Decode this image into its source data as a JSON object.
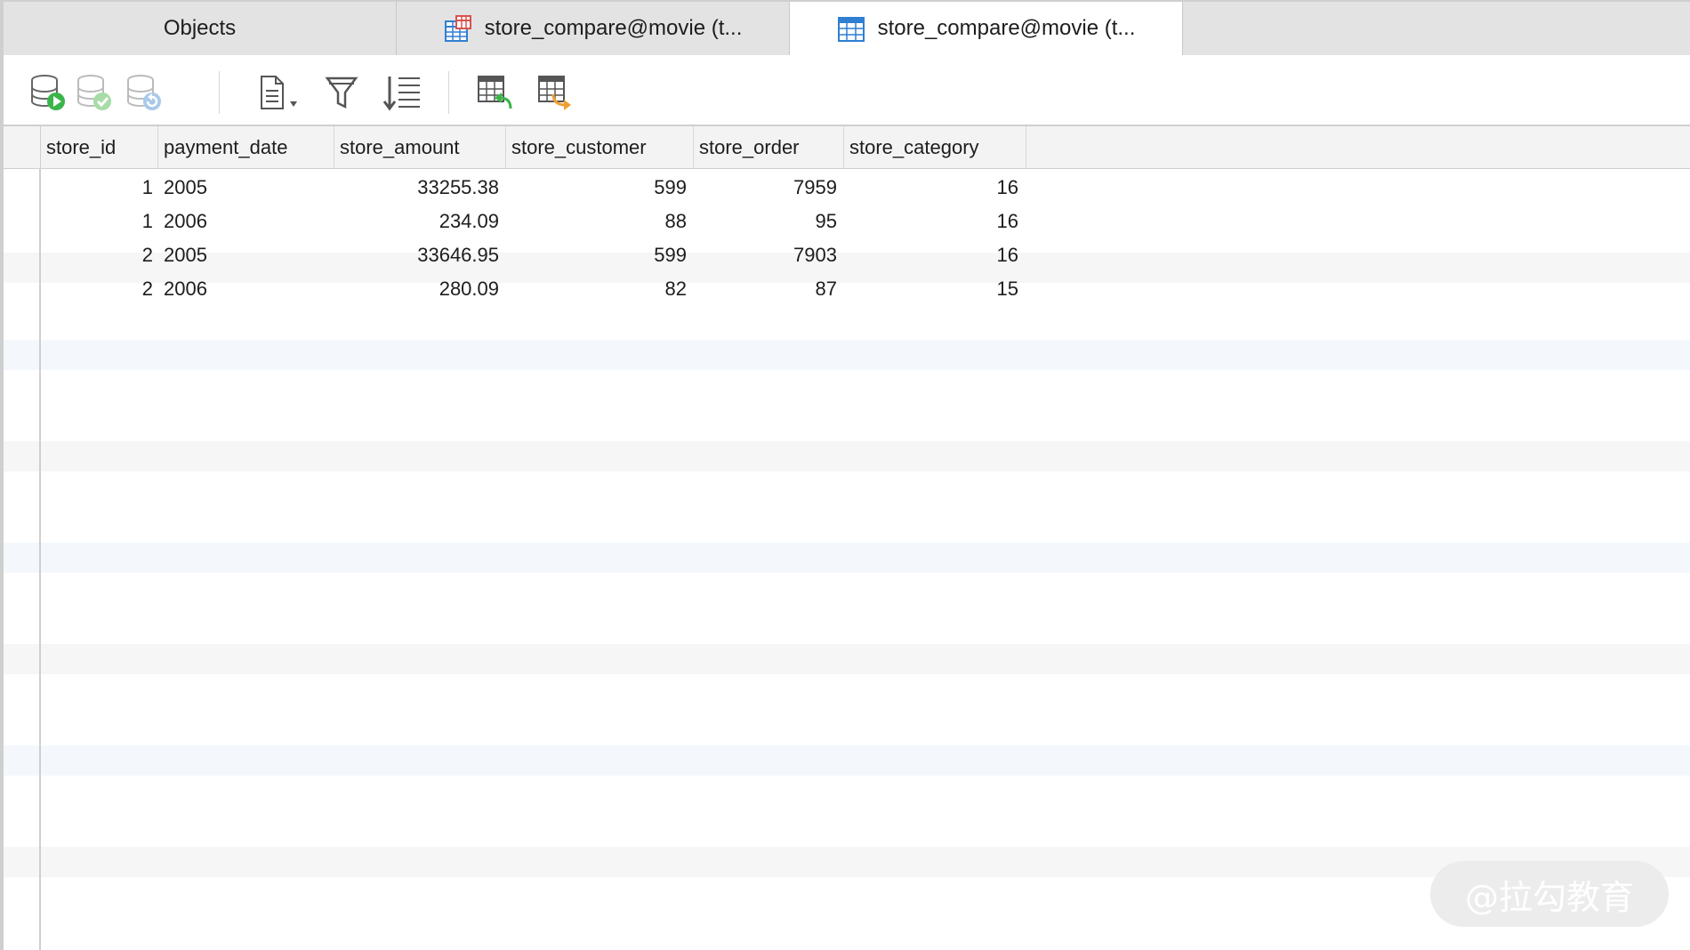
{
  "tabs": [
    {
      "label": "Objects",
      "icon": "",
      "active": false
    },
    {
      "label": "store_compare@movie (t...",
      "icon": "table-red-icon",
      "active": false
    },
    {
      "label": "store_compare@movie (t...",
      "icon": "table-blue-icon",
      "active": true
    }
  ],
  "toolbar": {
    "buttons": [
      "begin-transaction-icon",
      "commit-icon",
      "rollback-icon",
      "text-view-icon",
      "filter-icon",
      "sort-icon",
      "import-icon",
      "export-icon"
    ]
  },
  "grid": {
    "columns": [
      "store_id",
      "payment_date",
      "store_amount",
      "store_customer",
      "store_order",
      "store_category"
    ],
    "rows": [
      [
        "1",
        "2005",
        "33255.38",
        "599",
        "7959",
        "16"
      ],
      [
        "1",
        "2006",
        "234.09",
        "88",
        "95",
        "16"
      ],
      [
        "2",
        "2005",
        "33646.95",
        "599",
        "7903",
        "16"
      ],
      [
        "2",
        "2006",
        "280.09",
        "82",
        "87",
        "15"
      ]
    ]
  },
  "watermark": "@拉勾教育",
  "colors": {
    "accent_blue": "#2f7fd3",
    "accent_red": "#d9534f",
    "play_green": "#3bb54a",
    "header_bg": "#f3f3f3",
    "tab_bg": "#e3e3e3"
  }
}
